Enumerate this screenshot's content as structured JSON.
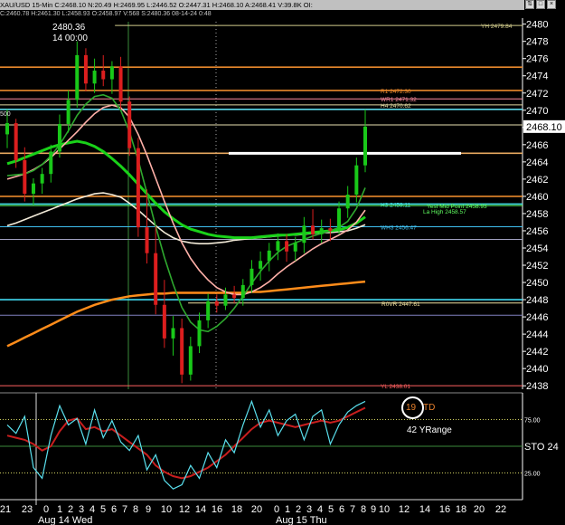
{
  "header": {
    "text": "XAU/USD 15-Min C:2468.10 N:20.49 H:2469.95 L:2446.52 O:2447.31 H:2468.10 A:2468.41 V:39.8K OI:",
    "subtext": "C:2460.78 H:2461.30 L:2458.93 O:2458.97 V:568 S:2480.36 08-14-24 0:48",
    "icons": [
      "sort-icon",
      "maximize-icon",
      "close-icon"
    ]
  },
  "crosshair_readout": {
    "price": "2480.36",
    "time": "14 00:00"
  },
  "side_label": "500",
  "chart_data": {
    "type": "candlestick",
    "instrument": "XAU/USD",
    "interval": "15-Min",
    "ylim": [
      2437.6,
      2480.7
    ],
    "y_ticks": [
      2438,
      2440,
      2442,
      2444,
      2446,
      2448,
      2450,
      2452,
      2454,
      2456,
      2458,
      2460,
      2462,
      2464,
      2466,
      2468,
      2470,
      2472,
      2474,
      2476,
      2478,
      2480
    ],
    "last_price": 2468.1,
    "last_price_label": "2468.10",
    "candles": [
      [
        2467.2,
        2470.1,
        2465.6,
        2468.5
      ],
      [
        2468.5,
        2469.0,
        2463.3,
        2464.2
      ],
      [
        2464.2,
        2465.7,
        2459.4,
        2460.3
      ],
      [
        2460.3,
        2462.1,
        2459.0,
        2461.5
      ],
      [
        2461.5,
        2463.3,
        2460.3,
        2462.6
      ],
      [
        2462.6,
        2466.0,
        2461.6,
        2465.2
      ],
      [
        2465.2,
        2469.5,
        2464.5,
        2468.4
      ],
      [
        2468.4,
        2472.3,
        2467.4,
        2471.2
      ],
      [
        2471.2,
        2478.0,
        2470.3,
        2476.4
      ],
      [
        2476.4,
        2477.2,
        2472.2,
        2473.1
      ],
      [
        2473.1,
        2476.0,
        2472.0,
        2474.6
      ],
      [
        2474.6,
        2476.4,
        2472.8,
        2473.6
      ],
      [
        2473.6,
        2475.7,
        2471.9,
        2475.1
      ],
      [
        2475.1,
        2476.2,
        2470.1,
        2471.0
      ],
      [
        2471.0,
        2471.6,
        2464.7,
        2465.6
      ],
      [
        2465.6,
        2466.8,
        2455.3,
        2456.4
      ],
      [
        2456.4,
        2460.8,
        2452.2,
        2453.4
      ],
      [
        2453.4,
        2456.5,
        2446.3,
        2447.4
      ],
      [
        2447.4,
        2450.3,
        2442.4,
        2443.5
      ],
      [
        2443.5,
        2446.1,
        2441.5,
        2444.7
      ],
      [
        2444.7,
        2445.8,
        2438.3,
        2439.3
      ],
      [
        2439.3,
        2443.7,
        2438.6,
        2442.6
      ],
      [
        2442.6,
        2446.5,
        2441.8,
        2445.6
      ],
      [
        2445.6,
        2448.7,
        2444.7,
        2447.8
      ],
      [
        2447.8,
        2448.6,
        2446.5,
        2447.3
      ],
      [
        2447.3,
        2449.4,
        2446.8,
        2448.6
      ],
      [
        2448.6,
        2449.6,
        2447.6,
        2448.2
      ],
      [
        2448.2,
        2450.4,
        2447.3,
        2449.7
      ],
      [
        2449.7,
        2452.6,
        2448.8,
        2451.6
      ],
      [
        2451.6,
        2453.6,
        2450.2,
        2452.5
      ],
      [
        2452.5,
        2454.6,
        2451.3,
        2453.7
      ],
      [
        2453.7,
        2455.7,
        2452.6,
        2454.8
      ],
      [
        2454.8,
        2455.6,
        2452.4,
        2453.6
      ],
      [
        2453.6,
        2455.3,
        2452.5,
        2454.6
      ],
      [
        2454.6,
        2457.6,
        2453.4,
        2456.6
      ],
      [
        2456.6,
        2458.5,
        2455.0,
        2455.6
      ],
      [
        2455.6,
        2457.3,
        2454.6,
        2456.3
      ],
      [
        2456.3,
        2457.4,
        2454.8,
        2456.0
      ],
      [
        2456.0,
        2459.4,
        2455.6,
        2458.6
      ],
      [
        2458.6,
        2461.2,
        2457.5,
        2460.2
      ],
      [
        2460.2,
        2464.5,
        2459.3,
        2463.6
      ],
      [
        2463.6,
        2470.1,
        2462.8,
        2468.1
      ]
    ],
    "moving_averages": [
      {
        "color": "#ff8c1a",
        "values": [
          2442.6,
          2443.1,
          2443.6,
          2444.1,
          2444.6,
          2445.1,
          2445.6,
          2446.1,
          2446.6,
          2447.0,
          2447.4,
          2447.7,
          2448.0,
          2448.2,
          2448.4,
          2448.5,
          2448.6,
          2448.7,
          2448.7,
          2448.8,
          2448.8,
          2448.8,
          2448.8,
          2448.8,
          2448.8,
          2448.8,
          2448.8,
          2448.8,
          2448.9,
          2448.9,
          2449.0,
          2449.1,
          2449.2,
          2449.3,
          2449.4,
          2449.5,
          2449.6,
          2449.7,
          2449.8,
          2449.9,
          2450.0,
          2450.1
        ]
      },
      {
        "color": "#f2ead8",
        "values": [
          2456.6,
          2456.9,
          2457.3,
          2457.7,
          2458.1,
          2458.5,
          2458.9,
          2459.3,
          2459.7,
          2460.0,
          2460.3,
          2460.4,
          2460.2,
          2459.9,
          2459.2,
          2458.4,
          2457.5,
          2456.6,
          2455.8,
          2455.2,
          2454.8,
          2454.6,
          2454.5,
          2454.5,
          2454.6,
          2454.7,
          2454.9,
          2455.0,
          2455.1,
          2455.2,
          2455.3,
          2455.4,
          2455.5,
          2455.5,
          2455.6,
          2455.7,
          2455.8,
          2455.8,
          2455.9,
          2456.0,
          2456.3,
          2456.7
        ]
      },
      {
        "color": "#19d219",
        "values": [
          2463.8,
          2464.1,
          2464.5,
          2464.9,
          2465.3,
          2465.7,
          2466.0,
          2466.2,
          2466.4,
          2466.2,
          2465.8,
          2465.2,
          2464.4,
          2463.5,
          2462.5,
          2461.4,
          2460.3,
          2459.2,
          2458.2,
          2457.4,
          2456.7,
          2456.2,
          2455.9,
          2455.6,
          2455.4,
          2455.3,
          2455.2,
          2455.2,
          2455.2,
          2455.3,
          2455.4,
          2455.5,
          2455.5,
          2455.6,
          2455.7,
          2455.8,
          2455.9,
          2456.0,
          2456.1,
          2456.4,
          2456.9,
          2457.6
        ]
      },
      {
        "color": "#ffb0a8",
        "values": [
          2462.0,
          2462.3,
          2462.6,
          2463.1,
          2463.7,
          2464.5,
          2465.5,
          2466.5,
          2467.5,
          2468.6,
          2469.6,
          2470.3,
          2470.6,
          2470.3,
          2469.2,
          2467.2,
          2464.8,
          2462.1,
          2459.4,
          2456.9,
          2454.6,
          2452.8,
          2451.4,
          2450.3,
          2449.4,
          2448.9,
          2448.6,
          2448.6,
          2448.9,
          2449.4,
          2450.1,
          2451.0,
          2451.8,
          2452.5,
          2453.2,
          2453.9,
          2454.5,
          2455.0,
          2455.5,
          2456.1,
          2457.0,
          2458.4
        ]
      },
      {
        "color": "#2ea82e",
        "values": [
          2462.4,
          2462.5,
          2462.6,
          2463.0,
          2463.7,
          2464.7,
          2466.0,
          2467.6,
          2469.4,
          2470.7,
          2471.6,
          2471.8,
          2471.4,
          2470.0,
          2467.5,
          2464.2,
          2460.4,
          2456.5,
          2452.9,
          2449.8,
          2447.1,
          2445.4,
          2444.5,
          2444.3,
          2444.9,
          2445.8,
          2447.0,
          2448.4,
          2449.9,
          2451.3,
          2452.5,
          2453.5,
          2454.2,
          2454.6,
          2455.0,
          2455.4,
          2455.7,
          2456.0,
          2456.4,
          2457.1,
          2458.6,
          2461.0
        ]
      }
    ],
    "levels": [
      {
        "price": 2479.84,
        "color": "#d2cc8c",
        "label": "YH 2479.84",
        "style": "thin",
        "x_from": 0.22
      },
      {
        "price": 2475.0,
        "color": "#e8882c",
        "label": "",
        "style": "normal",
        "x_from": 0
      },
      {
        "price": 2472.3,
        "color": "#e8882c",
        "label": "R1 2472.30",
        "style": "normal",
        "x_from": 0
      },
      {
        "price": 2471.32,
        "color": "#ff8ca0",
        "label": "WR1 2471.32",
        "style": "thin",
        "x_from": 0
      },
      {
        "price": 2470.62,
        "color": "#e0d8a0",
        "label": "H4 2470.62",
        "style": "thin",
        "x_from": 0
      },
      {
        "price": 2470.1,
        "color": "#5ad8e8",
        "label": "",
        "style": "normal",
        "x_from": 0
      },
      {
        "price": 2468.3,
        "color": "#e8e0b0",
        "label": "",
        "style": "thin",
        "x_from": 0
      },
      {
        "price": 2465.0,
        "color": "#e8a860",
        "label": "",
        "style": "normal",
        "x_from": 0
      },
      {
        "price": 2460.0,
        "color": "#e8882c",
        "label": "",
        "style": "normal",
        "x_from": 0
      },
      {
        "price": 2459.11,
        "color": "#40e0e8",
        "label": "H3 2459.11",
        "style": "normal",
        "x_from": 0
      },
      {
        "price": 2458.93,
        "color": "#60ff60",
        "label": "Yest Mid Point 2458.93",
        "style": "thin",
        "x_from": 0
      },
      {
        "price": 2456.47,
        "color": "#40c0f0",
        "label": "WH3 2456.47",
        "style": "thin",
        "x_from": 0
      },
      {
        "price": 2455.0,
        "color": "#a0a0c0",
        "label": "",
        "style": "thin",
        "x_from": 0
      },
      {
        "price": 2448.0,
        "color": "#40d8f0",
        "label": "",
        "style": "normal",
        "x_from": 0
      },
      {
        "price": 2447.61,
        "color": "#f0e0a0",
        "label": "R0VR 2447.61",
        "style": "thin",
        "x_from": 0.36
      },
      {
        "price": 2446.2,
        "color": "#8080c0",
        "label": "",
        "style": "thin",
        "x_from": 0
      },
      {
        "price": 2438.01,
        "color": "#ff6060",
        "label": "YL 2438.01",
        "style": "thin",
        "x_from": 0
      }
    ],
    "extra_labels": [
      {
        "price": 2458.3,
        "color": "#60ff60",
        "text": "La High 2458.57"
      }
    ],
    "target_line": {
      "price": 2465.0,
      "color": "#ffffff"
    },
    "x_ticks_day1": [
      "21",
      "23",
      "0",
      "1",
      "2",
      "3",
      "4",
      "5",
      "6",
      "7",
      "8",
      "9",
      "10",
      "12",
      "14",
      "16",
      "18",
      "20",
      "22"
    ],
    "x_ticks_day2": [
      "0",
      "1",
      "2",
      "3",
      "4",
      "5",
      "6",
      "7",
      "8",
      "9",
      "10",
      "12",
      "14",
      "16",
      "18",
      "20",
      "22"
    ],
    "date_labels": [
      "Aug 14 Wed",
      "Aug 15 Thu"
    ],
    "stoch": {
      "ylim": [
        0,
        100
      ],
      "y_ticks": [
        "75.00",
        "25.00"
      ],
      "label": "STO",
      "value": "24",
      "k_color": "#5ae0ee",
      "d_color": "#c81e1e",
      "k": [
        70,
        62,
        78,
        30,
        20,
        60,
        88,
        70,
        76,
        52,
        84,
        58,
        74,
        54,
        46,
        60,
        28,
        42,
        18,
        10,
        14,
        32,
        20,
        44,
        30,
        56,
        44,
        70,
        92,
        68,
        84,
        60,
        74,
        80,
        56,
        78,
        84,
        52,
        70,
        82,
        88,
        92
      ],
      "d": [
        60,
        58,
        56,
        52,
        46,
        50,
        64,
        74,
        76,
        66,
        68,
        64,
        66,
        60,
        54,
        48,
        42,
        32,
        26,
        22,
        20,
        22,
        26,
        30,
        36,
        42,
        50,
        58,
        66,
        72,
        74,
        72,
        70,
        68,
        70,
        72,
        74,
        72,
        74,
        78,
        82,
        86
      ]
    }
  },
  "annotations": {
    "circle_value": "19",
    "circle_suffix": "TD",
    "yrange": "42 YRange"
  }
}
